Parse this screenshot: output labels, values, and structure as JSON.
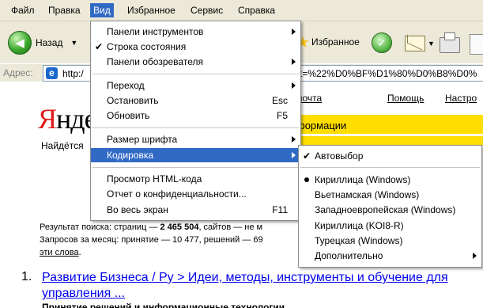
{
  "menubar": {
    "items": [
      "Файл",
      "Правка",
      "Вид",
      "Избранное",
      "Сервис",
      "Справка"
    ]
  },
  "toolbar": {
    "back_label": "Назад",
    "favorites_label": "Избранное"
  },
  "address": {
    "label": "Адрес:",
    "value_start": "http:/",
    "value_end": "t=%22%D0%BF%D1%80%D0%B8%D0%"
  },
  "page": {
    "logo_first": "Я",
    "logo_rest": "нде",
    "tagline": "Найдётся",
    "nav": [
      "почта",
      "Помощь",
      "Настро"
    ],
    "yellow_text": "формации",
    "results_line1": "Результат поиска: страниц — ",
    "results_pages": "2 465 504",
    "results_line1_end": ", сайтов — не м",
    "results_line2": "Запросов за месяц: принятие — 10 477, решений — 69",
    "results_line3_link": "эти слова",
    "results_line3_end": ".",
    "item1_number": "1.",
    "item1_title": "Развитие Бизнеса / Ру > Идеи, методы, инструменты и обучение для управления ...",
    "item1_sub": "Принятие решений и информационные технологии"
  },
  "view_menu": {
    "items": [
      {
        "label": "Панели инструментов",
        "submenu": true
      },
      {
        "label": "Строка состояния",
        "checked": true
      },
      {
        "label": "Панели обозревателя",
        "submenu": true
      },
      {
        "label": "Переход",
        "submenu": true
      },
      {
        "label": "Остановить",
        "shortcut": "Esc"
      },
      {
        "label": "Обновить",
        "shortcut": "F5"
      },
      {
        "label": "Размер шрифта",
        "submenu": true
      },
      {
        "label": "Кодировка",
        "submenu": true,
        "highlighted": true
      },
      {
        "label": "Просмотр HTML-кода"
      },
      {
        "label": "Отчет о конфиденциальности..."
      },
      {
        "label": "Во весь экран",
        "shortcut": "F11"
      }
    ]
  },
  "encoding_menu": {
    "items": [
      {
        "label": "Автовыбор",
        "checked": true
      },
      {
        "label": "Кириллица (Windows)",
        "selected": true
      },
      {
        "label": "Вьетнамская (Windows)"
      },
      {
        "label": "Западноевропейская (Windows)"
      },
      {
        "label": "Кириллица (KOI8-R)"
      },
      {
        "label": "Турецкая (Windows)"
      },
      {
        "label": "Дополнительно",
        "submenu": true
      }
    ]
  },
  "colors": {
    "highlight": "#316ac5",
    "link": "#0000ee",
    "yandex_red": "#e01a1a",
    "yandex_yellow": "#ffde00"
  }
}
